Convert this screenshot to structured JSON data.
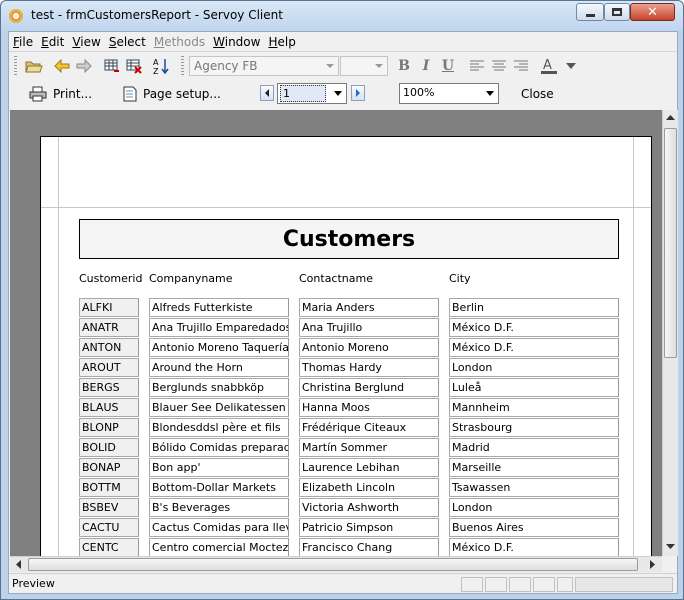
{
  "window": {
    "title": "test - frmCustomersReport - Servoy Client"
  },
  "menu": [
    {
      "pre": "",
      "u": "F",
      "post": "ile",
      "disabled": false
    },
    {
      "pre": "",
      "u": "E",
      "post": "dit",
      "disabled": false
    },
    {
      "pre": "",
      "u": "V",
      "post": "iew",
      "disabled": false
    },
    {
      "pre": "",
      "u": "S",
      "post": "elect",
      "disabled": false
    },
    {
      "pre": "",
      "u": "M",
      "post": "ethods",
      "disabled": true
    },
    {
      "pre": "",
      "u": "W",
      "post": "indow",
      "disabled": false
    },
    {
      "pre": "",
      "u": "H",
      "post": "elp",
      "disabled": false
    }
  ],
  "toolbar": {
    "font_combo": "Agency FB",
    "print_label": "Print...",
    "page_setup_label": "Page setup...",
    "page_value": "1",
    "zoom_value": "100%",
    "close_label": "Close"
  },
  "report": {
    "title": "Customers",
    "columns": [
      "Customerid",
      "Companyname",
      "Contactname",
      "City"
    ],
    "rows": [
      [
        "ALFKI",
        "Alfreds Futterkiste",
        "Maria Anders",
        "Berlin"
      ],
      [
        "ANATR",
        "Ana Trujillo Emparedados y h",
        "Ana Trujillo",
        "México D.F."
      ],
      [
        "ANTON",
        "Antonio Moreno Taquería",
        "Antonio Moreno",
        "México D.F."
      ],
      [
        "AROUT",
        "Around the Horn",
        "Thomas Hardy",
        "London"
      ],
      [
        "BERGS",
        "Berglunds snabbköp",
        "Christina Berglund",
        "Luleå"
      ],
      [
        "BLAUS",
        "Blauer See Delikatessen",
        "Hanna Moos",
        "Mannheim"
      ],
      [
        "BLONP",
        "Blondesddsl père et fils",
        "Frédérique Citeaux",
        "Strasbourg"
      ],
      [
        "BOLID",
        "Bólido Comidas preparadas",
        "Martín Sommer",
        "Madrid"
      ],
      [
        "BONAP",
        "Bon app'",
        "Laurence Lebihan",
        "Marseille"
      ],
      [
        "BOTTM",
        "Bottom-Dollar Markets",
        "Elizabeth Lincoln",
        "Tsawassen"
      ],
      [
        "BSBEV",
        "B's Beverages",
        "Victoria Ashworth",
        "London"
      ],
      [
        "CACTU",
        "Cactus Comidas para llevar",
        "Patricio Simpson",
        "Buenos Aires"
      ],
      [
        "CENTC",
        "Centro comercial Moctezuma",
        "Francisco Chang",
        "México D.F."
      ]
    ]
  },
  "status": {
    "text": "Preview"
  }
}
